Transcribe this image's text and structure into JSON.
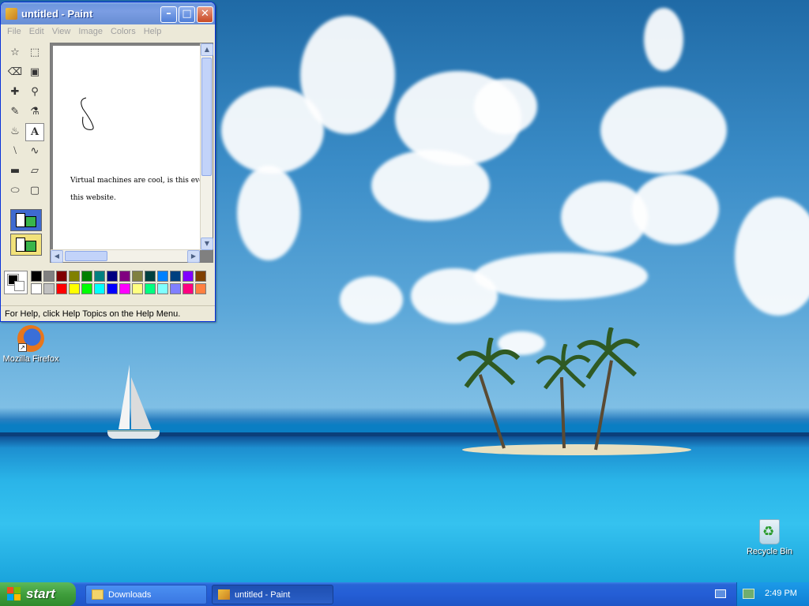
{
  "paint": {
    "title": "untitled - Paint",
    "menus": [
      "File",
      "Edit",
      "View",
      "Image",
      "Colors",
      "Help"
    ],
    "canvas_text_line1": "Virtual machines are cool, is this ever",
    "canvas_text_line2": "this website.",
    "status": "For Help, click Help Topics on the Help Menu.",
    "tools": [
      "free-form-select",
      "select",
      "eraser",
      "fill-with-color",
      "pick-color",
      "magnifier",
      "pencil",
      "brush",
      "airbrush",
      "text",
      "line",
      "curve",
      "rectangle",
      "polygon",
      "ellipse",
      "rounded-rectangle"
    ],
    "selected_tool": "text",
    "palette_top": [
      "#000000",
      "#808080",
      "#800000",
      "#808000",
      "#008000",
      "#008080",
      "#000080",
      "#800080",
      "#808040",
      "#004040",
      "#0080ff",
      "#004080",
      "#8000ff",
      "#804000"
    ],
    "palette_bottom": [
      "#ffffff",
      "#c0c0c0",
      "#ff0000",
      "#ffff00",
      "#00ff00",
      "#00ffff",
      "#0000ff",
      "#ff00ff",
      "#ffff80",
      "#00ff80",
      "#80ffff",
      "#8080ff",
      "#ff0080",
      "#ff8040"
    ],
    "foreground_color": "#000000",
    "background_color": "#ffffff"
  },
  "desktop": {
    "icons": [
      {
        "label": "Mozilla Firefox",
        "icon": "firefox-icon"
      },
      {
        "label": "Recycle Bin",
        "icon": "recycle-bin-icon"
      }
    ]
  },
  "taskbar": {
    "start_label": "start",
    "tasks": [
      {
        "label": "Downloads",
        "icon": "folder-icon",
        "active": false
      },
      {
        "label": "untitled - Paint",
        "icon": "paint-icon",
        "active": true
      }
    ],
    "clock": "2:49 PM"
  }
}
